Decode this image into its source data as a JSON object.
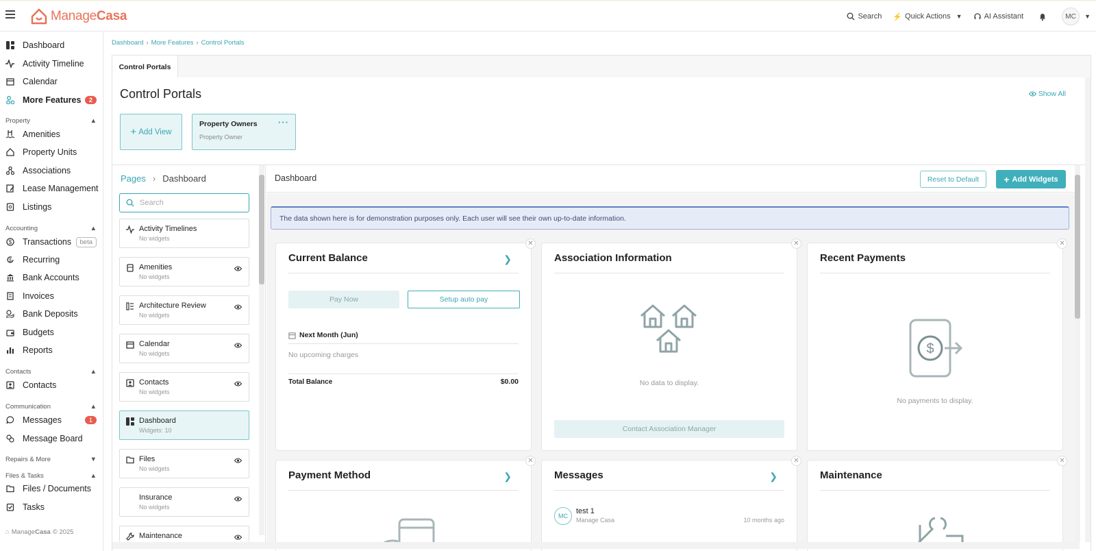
{
  "app": {
    "logo_prefix": "Manage",
    "logo_suffix": "Casa"
  },
  "topbar": {
    "search_label": "Search",
    "quick_actions_label": "Quick Actions",
    "ai_assistant_label": "AI Assistant",
    "user_initials": "MC"
  },
  "sidebar": {
    "main_items": [
      {
        "label": "Dashboard",
        "icon": "dashboard-icon"
      },
      {
        "label": "Activity Timeline",
        "icon": "activity-icon"
      },
      {
        "label": "Calendar",
        "icon": "calendar-icon"
      },
      {
        "label": "More Features",
        "icon": "features-icon",
        "badge": "2"
      }
    ],
    "sections": {
      "property": "Property",
      "accounting": "Accounting",
      "contacts": "Contacts",
      "communication": "Communication",
      "repairs": "Repairs & More",
      "files": "Files & Tasks"
    },
    "property_items": [
      "Amenities",
      "Property Units",
      "Associations",
      "Lease Management",
      "Listings"
    ],
    "accounting_items": [
      "Transactions",
      "Recurring",
      "Bank Accounts",
      "Invoices",
      "Bank Deposits",
      "Budgets",
      "Reports"
    ],
    "transactions_tag": "beta",
    "contacts_items": [
      "Contacts"
    ],
    "communication_items": [
      "Messages",
      "Message Board"
    ],
    "messages_badge": "1",
    "files_items": [
      "Files / Documents",
      "Tasks"
    ],
    "footer_prefix": "Manage",
    "footer_suffix": "Casa",
    "footer_year": "© 2025"
  },
  "breadcrumb": [
    "Dashboard",
    "More Features",
    "Control Portals"
  ],
  "tab_label": "Control Portals",
  "page_title": "Control Portals",
  "show_all_label": "Show All",
  "views": {
    "add_view_label": "Add View",
    "owner_title": "Property Owners",
    "owner_subtitle": "Property Owner"
  },
  "pages_panel": {
    "root_label": "Pages",
    "current_label": "Dashboard",
    "search_placeholder": "Search",
    "items": [
      {
        "title": "Activity Timelines",
        "sub": "No widgets",
        "eye": false
      },
      {
        "title": "Amenities",
        "sub": "No widgets",
        "eye": true
      },
      {
        "title": "Architecture Review",
        "sub": "No widgets",
        "eye": true
      },
      {
        "title": "Calendar",
        "sub": "No widgets",
        "eye": true
      },
      {
        "title": "Contacts",
        "sub": "No widgets",
        "eye": true
      },
      {
        "title": "Dashboard",
        "sub": "Widgets: 10",
        "eye": false,
        "active": true
      },
      {
        "title": "Files",
        "sub": "No widgets",
        "eye": true
      },
      {
        "title": "Insurance",
        "sub": "No widgets",
        "eye": true
      },
      {
        "title": "Maintenance",
        "sub": "",
        "eye": true
      }
    ]
  },
  "dashboard": {
    "title": "Dashboard",
    "reset_label": "Reset to Default",
    "add_widgets_label": "Add Widgets",
    "demo_notice": "The data shown here is for demonstration purposes only. Each user will see their own up-to-date information.",
    "widgets": {
      "balance": {
        "title": "Current Balance",
        "pay_now": "Pay Now",
        "setup_auto": "Setup auto pay",
        "next_month": "Next Month (Jun)",
        "no_charges": "No upcoming charges",
        "total_label": "Total Balance",
        "total_value": "$0.00"
      },
      "association": {
        "title": "Association Information",
        "empty": "No data to display.",
        "contact_button": "Contact Association Manager"
      },
      "payments": {
        "title": "Recent Payments",
        "empty": "No payments to display."
      },
      "payment_method": {
        "title": "Payment Method"
      },
      "messages": {
        "title": "Messages",
        "item_initials": "MC",
        "item_title": "test 1",
        "item_from": "Manage Casa",
        "item_time": "10 months ago"
      },
      "maintenance": {
        "title": "Maintenance"
      }
    }
  },
  "colors": {
    "brand": "#e8735b",
    "accent": "#3aa6b3",
    "badge": "#e95b4e"
  }
}
